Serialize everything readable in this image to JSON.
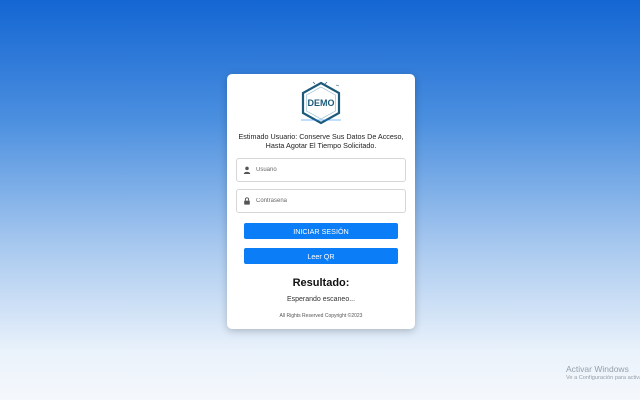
{
  "logo": {
    "text": "DEMO"
  },
  "message": {
    "line1": "Estimado Usuario: Conserve Sus Datos De Acceso,",
    "line2": "Hasta Agotar El Tiempo Solicitado."
  },
  "form": {
    "username_placeholder": "Usuario",
    "username_icon": "user-icon",
    "password_placeholder": "Contraseña",
    "password_icon": "lock-icon",
    "login_label": "INICIAR SESIÓN",
    "qr_label": "Leer QR"
  },
  "result": {
    "title": "Resultado:",
    "status": "Esperando escaneo..."
  },
  "footer": {
    "copyright": "All Rights Reserved Copyright ©2023"
  },
  "watermark": {
    "title": "Activar Windows",
    "subtitle": "Ve a Configuración para activar Windows."
  },
  "colors": {
    "primary": "#0a7df7",
    "logo": "#1c5a7a"
  }
}
